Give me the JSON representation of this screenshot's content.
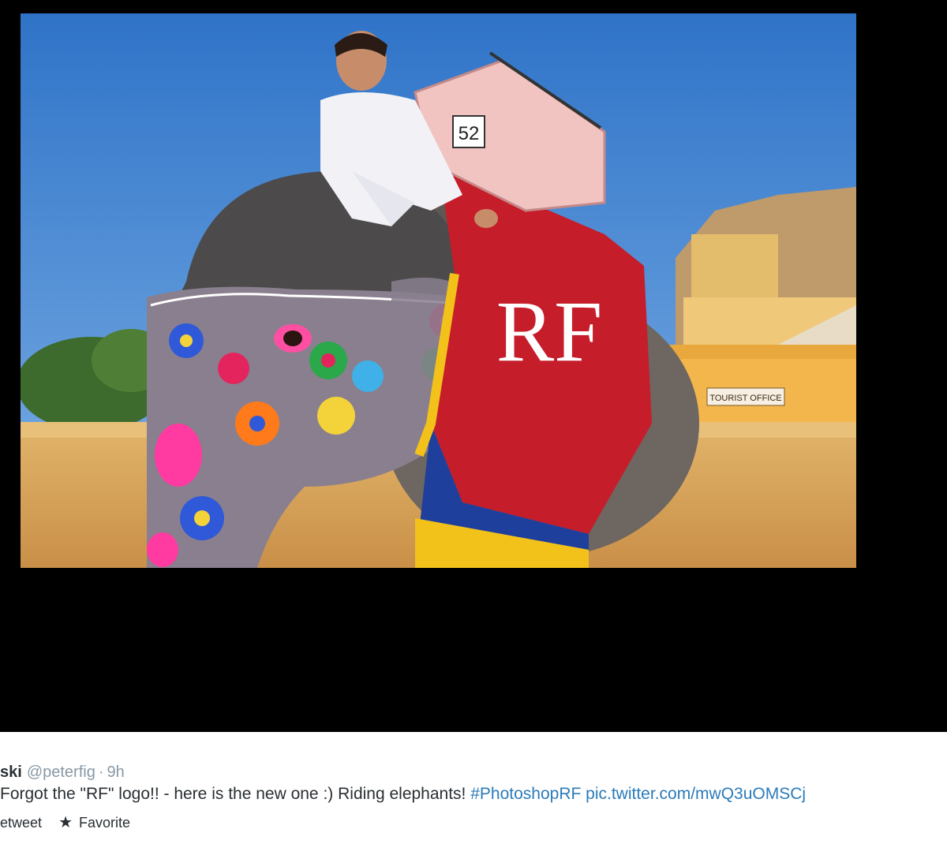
{
  "tweet": {
    "name": "ski",
    "handle": "@peterfig",
    "separator": "·",
    "time": "9h",
    "text_plain": "Forgot the \"RF\" logo!! - here is the new one :) Riding elephants!",
    "hashtag": "#PhotoshopRF",
    "pic_link": "pic.twitter.com/mwQ3uOMSCj",
    "actions": {
      "retweet_label": "etweet",
      "favorite_label": "Favorite",
      "favorite_icon": "star-icon"
    }
  },
  "photo": {
    "logo_text": "RF",
    "number_plate": "52",
    "sign_text": "TOURIST OFFICE"
  },
  "colors": {
    "media_background": "#000000",
    "link": "#2b7bb9",
    "meta_gray": "#8899a6",
    "text": "#292f33",
    "sky": "#3f83d3",
    "blanket_red": "#c61d2b"
  }
}
